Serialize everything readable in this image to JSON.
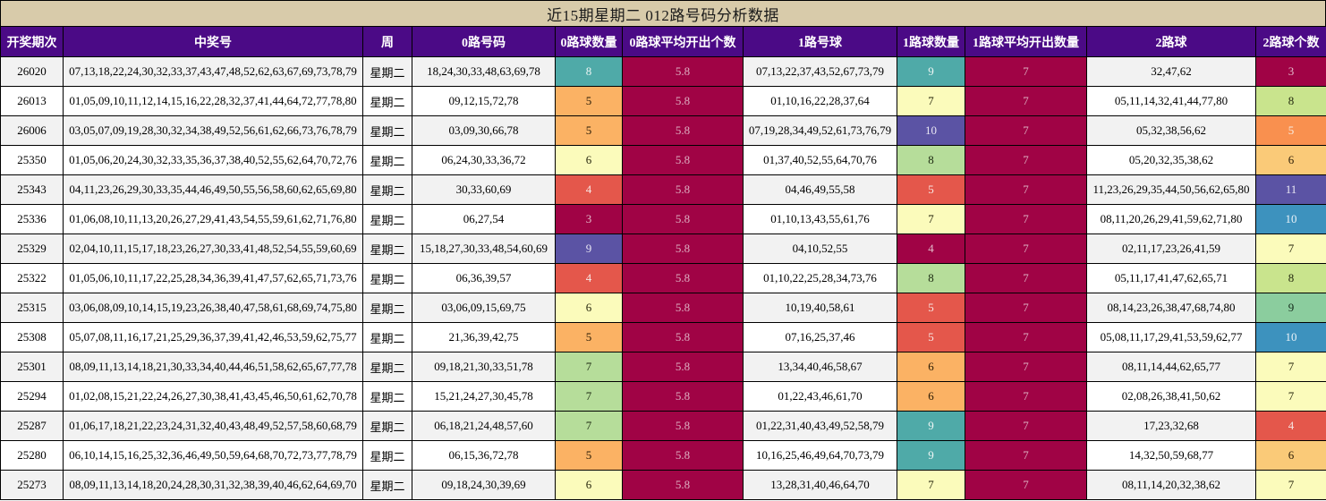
{
  "title": "近15期星期二 012路号码分析数据",
  "colors": {
    "header_bg": "#4b0a86",
    "title_bg": "#d8cbaa",
    "row_odd_bg": "#f2f2f2",
    "row_even_bg": "#ffffff",
    "border": "#000000",
    "palette": {
      "crimson": {
        "bg": "#a00345",
        "fg": "#e3bccb"
      },
      "red": {
        "bg": "#e4574b",
        "fg": "#f7e6e3"
      },
      "darkorange": {
        "bg": "#f9904f",
        "fg": "#f8ece2"
      },
      "orange": {
        "bg": "#fbb264",
        "fg": "#2a1c06"
      },
      "amber": {
        "bg": "#faca78",
        "fg": "#2a1c06"
      },
      "paleyellow": {
        "bg": "#fbfbbb",
        "fg": "#27270d"
      },
      "lightgreen": {
        "bg": "#b6dd9a",
        "fg": "#1d2a12"
      },
      "yellowgreen": {
        "bg": "#c9e48d",
        "fg": "#23290f"
      },
      "green": {
        "bg": "#8bcd9e",
        "fg": "#132a1a"
      },
      "teal": {
        "bg": "#4faaa8",
        "fg": "#eef5f4"
      },
      "blue": {
        "bg": "#3d92be",
        "fg": "#eaf3f8"
      },
      "purple": {
        "bg": "#5b53a4",
        "fg": "#e9e7f4"
      },
      "avg": {
        "bg": "#a00345",
        "fg": "#dcaec0"
      }
    }
  },
  "columns": [
    {
      "key": "period",
      "label": "开奖期次"
    },
    {
      "key": "winning",
      "label": "中奖号"
    },
    {
      "key": "week",
      "label": "周"
    },
    {
      "key": "road0_numbers",
      "label": "0路号码"
    },
    {
      "key": "road0_count",
      "label": "0路球数量"
    },
    {
      "key": "road0_avg",
      "label": "0路球平均开出个数"
    },
    {
      "key": "road1_numbers",
      "label": "1路号球"
    },
    {
      "key": "road1_count",
      "label": "1路球数量"
    },
    {
      "key": "road1_avg",
      "label": "1路球平均开出数量"
    },
    {
      "key": "road2_numbers",
      "label": "2路球"
    },
    {
      "key": "road2_count",
      "label": "2路球个数"
    }
  ],
  "rows": [
    {
      "period": "26020",
      "winning": "07,13,18,22,24,30,32,33,37,43,47,48,52,62,63,67,69,73,78,79",
      "week": "星期二",
      "road0_numbers": "18,24,30,33,48,63,69,78",
      "road0_count": {
        "v": "8",
        "c": "teal"
      },
      "road0_avg": {
        "v": "5.8",
        "c": "avg"
      },
      "road1_numbers": "07,13,22,37,43,52,67,73,79",
      "road1_count": {
        "v": "9",
        "c": "teal"
      },
      "road1_avg": {
        "v": "7",
        "c": "avg"
      },
      "road2_numbers": "32,47,62",
      "road2_count": {
        "v": "3",
        "c": "crimson"
      }
    },
    {
      "period": "26013",
      "winning": "01,05,09,10,11,12,14,15,16,22,28,32,37,41,44,64,72,77,78,80",
      "week": "星期二",
      "road0_numbers": "09,12,15,72,78",
      "road0_count": {
        "v": "5",
        "c": "orange"
      },
      "road0_avg": {
        "v": "5.8",
        "c": "avg"
      },
      "road1_numbers": "01,10,16,22,28,37,64",
      "road1_count": {
        "v": "7",
        "c": "paleyellow"
      },
      "road1_avg": {
        "v": "7",
        "c": "avg"
      },
      "road2_numbers": "05,11,14,32,41,44,77,80",
      "road2_count": {
        "v": "8",
        "c": "yellowgreen"
      }
    },
    {
      "period": "26006",
      "winning": "03,05,07,09,19,28,30,32,34,38,49,52,56,61,62,66,73,76,78,79",
      "week": "星期二",
      "road0_numbers": "03,09,30,66,78",
      "road0_count": {
        "v": "5",
        "c": "orange"
      },
      "road0_avg": {
        "v": "5.8",
        "c": "avg"
      },
      "road1_numbers": "07,19,28,34,49,52,61,73,76,79",
      "road1_count": {
        "v": "10",
        "c": "purple"
      },
      "road1_avg": {
        "v": "7",
        "c": "avg"
      },
      "road2_numbers": "05,32,38,56,62",
      "road2_count": {
        "v": "5",
        "c": "darkorange"
      }
    },
    {
      "period": "25350",
      "winning": "01,05,06,20,24,30,32,33,35,36,37,38,40,52,55,62,64,70,72,76",
      "week": "星期二",
      "road0_numbers": "06,24,30,33,36,72",
      "road0_count": {
        "v": "6",
        "c": "paleyellow"
      },
      "road0_avg": {
        "v": "5.8",
        "c": "avg"
      },
      "road1_numbers": "01,37,40,52,55,64,70,76",
      "road1_count": {
        "v": "8",
        "c": "lightgreen"
      },
      "road1_avg": {
        "v": "7",
        "c": "avg"
      },
      "road2_numbers": "05,20,32,35,38,62",
      "road2_count": {
        "v": "6",
        "c": "amber"
      }
    },
    {
      "period": "25343",
      "winning": "04,11,23,26,29,30,33,35,44,46,49,50,55,56,58,60,62,65,69,80",
      "week": "星期二",
      "road0_numbers": "30,33,60,69",
      "road0_count": {
        "v": "4",
        "c": "red"
      },
      "road0_avg": {
        "v": "5.8",
        "c": "avg"
      },
      "road1_numbers": "04,46,49,55,58",
      "road1_count": {
        "v": "5",
        "c": "red"
      },
      "road1_avg": {
        "v": "7",
        "c": "avg"
      },
      "road2_numbers": "11,23,26,29,35,44,50,56,62,65,80",
      "road2_count": {
        "v": "11",
        "c": "purple"
      }
    },
    {
      "period": "25336",
      "winning": "01,06,08,10,11,13,20,26,27,29,41,43,54,55,59,61,62,71,76,80",
      "week": "星期二",
      "road0_numbers": "06,27,54",
      "road0_count": {
        "v": "3",
        "c": "crimson"
      },
      "road0_avg": {
        "v": "5.8",
        "c": "avg"
      },
      "road1_numbers": "01,10,13,43,55,61,76",
      "road1_count": {
        "v": "7",
        "c": "paleyellow"
      },
      "road1_avg": {
        "v": "7",
        "c": "avg"
      },
      "road2_numbers": "08,11,20,26,29,41,59,62,71,80",
      "road2_count": {
        "v": "10",
        "c": "blue"
      }
    },
    {
      "period": "25329",
      "winning": "02,04,10,11,15,17,18,23,26,27,30,33,41,48,52,54,55,59,60,69",
      "week": "星期二",
      "road0_numbers": "15,18,27,30,33,48,54,60,69",
      "road0_count": {
        "v": "9",
        "c": "purple"
      },
      "road0_avg": {
        "v": "5.8",
        "c": "avg"
      },
      "road1_numbers": "04,10,52,55",
      "road1_count": {
        "v": "4",
        "c": "crimson"
      },
      "road1_avg": {
        "v": "7",
        "c": "avg"
      },
      "road2_numbers": "02,11,17,23,26,41,59",
      "road2_count": {
        "v": "7",
        "c": "paleyellow"
      }
    },
    {
      "period": "25322",
      "winning": "01,05,06,10,11,17,22,25,28,34,36,39,41,47,57,62,65,71,73,76",
      "week": "星期二",
      "road0_numbers": "06,36,39,57",
      "road0_count": {
        "v": "4",
        "c": "red"
      },
      "road0_avg": {
        "v": "5.8",
        "c": "avg"
      },
      "road1_numbers": "01,10,22,25,28,34,73,76",
      "road1_count": {
        "v": "8",
        "c": "lightgreen"
      },
      "road1_avg": {
        "v": "7",
        "c": "avg"
      },
      "road2_numbers": "05,11,17,41,47,62,65,71",
      "road2_count": {
        "v": "8",
        "c": "yellowgreen"
      }
    },
    {
      "period": "25315",
      "winning": "03,06,08,09,10,14,15,19,23,26,38,40,47,58,61,68,69,74,75,80",
      "week": "星期二",
      "road0_numbers": "03,06,09,15,69,75",
      "road0_count": {
        "v": "6",
        "c": "paleyellow"
      },
      "road0_avg": {
        "v": "5.8",
        "c": "avg"
      },
      "road1_numbers": "10,19,40,58,61",
      "road1_count": {
        "v": "5",
        "c": "red"
      },
      "road1_avg": {
        "v": "7",
        "c": "avg"
      },
      "road2_numbers": "08,14,23,26,38,47,68,74,80",
      "road2_count": {
        "v": "9",
        "c": "green"
      }
    },
    {
      "period": "25308",
      "winning": "05,07,08,11,16,17,21,25,29,36,37,39,41,42,46,53,59,62,75,77",
      "week": "星期二",
      "road0_numbers": "21,36,39,42,75",
      "road0_count": {
        "v": "5",
        "c": "orange"
      },
      "road0_avg": {
        "v": "5.8",
        "c": "avg"
      },
      "road1_numbers": "07,16,25,37,46",
      "road1_count": {
        "v": "5",
        "c": "red"
      },
      "road1_avg": {
        "v": "7",
        "c": "avg"
      },
      "road2_numbers": "05,08,11,17,29,41,53,59,62,77",
      "road2_count": {
        "v": "10",
        "c": "blue"
      }
    },
    {
      "period": "25301",
      "winning": "08,09,11,13,14,18,21,30,33,34,40,44,46,51,58,62,65,67,77,78",
      "week": "星期二",
      "road0_numbers": "09,18,21,30,33,51,78",
      "road0_count": {
        "v": "7",
        "c": "lightgreen"
      },
      "road0_avg": {
        "v": "5.8",
        "c": "avg"
      },
      "road1_numbers": "13,34,40,46,58,67",
      "road1_count": {
        "v": "6",
        "c": "orange"
      },
      "road1_avg": {
        "v": "7",
        "c": "avg"
      },
      "road2_numbers": "08,11,14,44,62,65,77",
      "road2_count": {
        "v": "7",
        "c": "paleyellow"
      }
    },
    {
      "period": "25294",
      "winning": "01,02,08,15,21,22,24,26,27,30,38,41,43,45,46,50,61,62,70,78",
      "week": "星期二",
      "road0_numbers": "15,21,24,27,30,45,78",
      "road0_count": {
        "v": "7",
        "c": "lightgreen"
      },
      "road0_avg": {
        "v": "5.8",
        "c": "avg"
      },
      "road1_numbers": "01,22,43,46,61,70",
      "road1_count": {
        "v": "6",
        "c": "orange"
      },
      "road1_avg": {
        "v": "7",
        "c": "avg"
      },
      "road2_numbers": "02,08,26,38,41,50,62",
      "road2_count": {
        "v": "7",
        "c": "paleyellow"
      }
    },
    {
      "period": "25287",
      "winning": "01,06,17,18,21,22,23,24,31,32,40,43,48,49,52,57,58,60,68,79",
      "week": "星期二",
      "road0_numbers": "06,18,21,24,48,57,60",
      "road0_count": {
        "v": "7",
        "c": "lightgreen"
      },
      "road0_avg": {
        "v": "5.8",
        "c": "avg"
      },
      "road1_numbers": "01,22,31,40,43,49,52,58,79",
      "road1_count": {
        "v": "9",
        "c": "teal"
      },
      "road1_avg": {
        "v": "7",
        "c": "avg"
      },
      "road2_numbers": "17,23,32,68",
      "road2_count": {
        "v": "4",
        "c": "red"
      }
    },
    {
      "period": "25280",
      "winning": "06,10,14,15,16,25,32,36,46,49,50,59,64,68,70,72,73,77,78,79",
      "week": "星期二",
      "road0_numbers": "06,15,36,72,78",
      "road0_count": {
        "v": "5",
        "c": "orange"
      },
      "road0_avg": {
        "v": "5.8",
        "c": "avg"
      },
      "road1_numbers": "10,16,25,46,49,64,70,73,79",
      "road1_count": {
        "v": "9",
        "c": "teal"
      },
      "road1_avg": {
        "v": "7",
        "c": "avg"
      },
      "road2_numbers": "14,32,50,59,68,77",
      "road2_count": {
        "v": "6",
        "c": "amber"
      }
    },
    {
      "period": "25273",
      "winning": "08,09,11,13,14,18,20,24,28,30,31,32,38,39,40,46,62,64,69,70",
      "week": "星期二",
      "road0_numbers": "09,18,24,30,39,69",
      "road0_count": {
        "v": "6",
        "c": "paleyellow"
      },
      "road0_avg": {
        "v": "5.8",
        "c": "avg"
      },
      "road1_numbers": "13,28,31,40,46,64,70",
      "road1_count": {
        "v": "7",
        "c": "paleyellow"
      },
      "road1_avg": {
        "v": "7",
        "c": "avg"
      },
      "road2_numbers": "08,11,14,20,32,38,62",
      "road2_count": {
        "v": "7",
        "c": "paleyellow"
      }
    }
  ]
}
